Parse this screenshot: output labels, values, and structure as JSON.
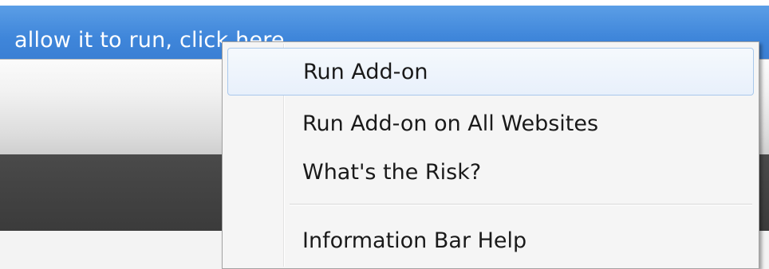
{
  "info_bar": {
    "text": "allow it to run, click here..."
  },
  "context_menu": {
    "items": [
      {
        "label": "Run Add-on",
        "highlighted": true
      },
      {
        "label": "Run Add-on on All Websites",
        "highlighted": false
      },
      {
        "label": "What's the Risk?",
        "highlighted": false
      },
      {
        "label": "Information Bar Help",
        "highlighted": false
      }
    ]
  },
  "colors": {
    "info_bar": "#3f86da",
    "menu_background": "#f5f5f5",
    "menu_highlight_border": "#a8c8ec",
    "dark_band": "#404040"
  }
}
